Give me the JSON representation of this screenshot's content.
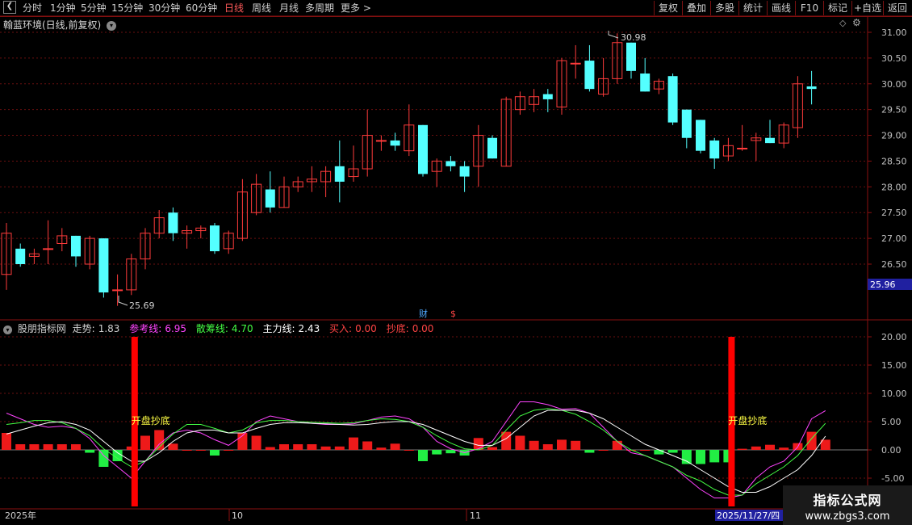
{
  "toolbar": {
    "periods": [
      "分时",
      "1分钟",
      "5分钟",
      "15分钟",
      "30分钟",
      "60分钟",
      "日线",
      "周线",
      "月线",
      "多周期",
      "更多 >"
    ],
    "active_period": "日线",
    "right_buttons": [
      "复权",
      "叠加",
      "多股",
      "统计",
      "画线",
      "F10",
      "标记",
      "+自选",
      "返回"
    ]
  },
  "stock_title": "翰蓝环境(日线,前复权)",
  "main_chart": {
    "y_ticks": [
      "31.00",
      "30.50",
      "30.00",
      "29.50",
      "29.00",
      "28.50",
      "28.00",
      "27.50",
      "27.00",
      "26.50"
    ],
    "price_ylim": [
      25.75,
      31.2
    ],
    "high_label": "30.98",
    "low_label": "25.69",
    "current_price": "25.96",
    "markers": {
      "cai": "财",
      "dollar": "$"
    }
  },
  "indicator": {
    "name": "股朋指标网",
    "items": [
      {
        "label": "走势:",
        "value": "1.83",
        "color": "#d0d0d0"
      },
      {
        "label": "参考线:",
        "value": "6.95",
        "color": "#ff44ff"
      },
      {
        "label": "散筹线:",
        "value": "4.70",
        "color": "#44ff44"
      },
      {
        "label": "主力线:",
        "value": "2.43",
        "color": "#ffffff"
      },
      {
        "label": "买入:",
        "value": "0.00",
        "color": "#ff4444"
      },
      {
        "label": "抄底:",
        "value": "0.00",
        "color": "#ff4444"
      }
    ],
    "y_ticks": [
      "20.00",
      "15.00",
      "10.00",
      "5.00",
      "0.00",
      "-5.00"
    ],
    "signal_text": "开盘抄底",
    "ylim": [
      -10.5,
      21.5
    ]
  },
  "xaxis": {
    "labels": [
      "2025年",
      "10",
      "11"
    ],
    "cursor_date": "2025/11/27/四"
  },
  "watermark": {
    "line1": "指标公式网",
    "line2": "www.zbgs3.com"
  },
  "chart_data": {
    "type": "candlestick",
    "candles": [
      [
        26.3,
        27.1,
        26.0,
        27.3
      ],
      [
        26.8,
        26.5,
        26.45,
        26.9
      ],
      [
        26.65,
        26.7,
        26.5,
        26.8
      ],
      [
        26.8,
        26.8,
        26.5,
        27.35
      ],
      [
        26.9,
        27.05,
        26.75,
        27.2
      ],
      [
        27.05,
        26.65,
        26.45,
        27.05
      ],
      [
        26.5,
        27.0,
        26.4,
        27.05
      ],
      [
        27.0,
        25.95,
        25.85,
        27.0
      ],
      [
        26.0,
        26.0,
        25.69,
        26.3
      ],
      [
        26.0,
        26.6,
        25.9,
        26.7
      ],
      [
        26.6,
        27.1,
        26.4,
        27.2
      ],
      [
        27.1,
        27.4,
        27.0,
        27.55
      ],
      [
        27.5,
        27.1,
        26.95,
        27.6
      ],
      [
        27.1,
        27.15,
        26.8,
        27.25
      ],
      [
        27.15,
        27.2,
        27.0,
        27.25
      ],
      [
        27.25,
        26.75,
        26.7,
        27.3
      ],
      [
        26.8,
        27.1,
        26.7,
        27.15
      ],
      [
        27.0,
        27.9,
        26.95,
        28.15
      ],
      [
        27.5,
        28.05,
        27.45,
        28.25
      ],
      [
        27.95,
        27.6,
        27.5,
        28.3
      ],
      [
        27.6,
        28.0,
        27.6,
        28.2
      ],
      [
        28.0,
        28.1,
        27.9,
        28.2
      ],
      [
        28.1,
        28.15,
        27.9,
        28.4
      ],
      [
        28.1,
        28.3,
        27.8,
        28.4
      ],
      [
        28.4,
        28.1,
        27.7,
        28.9
      ],
      [
        28.2,
        28.35,
        28.1,
        28.8
      ],
      [
        28.35,
        29.0,
        28.2,
        29.5
      ],
      [
        28.9,
        28.9,
        28.7,
        29.0
      ],
      [
        28.9,
        28.8,
        28.7,
        29.05
      ],
      [
        28.7,
        29.2,
        28.6,
        29.6
      ],
      [
        29.2,
        28.25,
        28.2,
        29.2
      ],
      [
        28.3,
        28.5,
        28.0,
        28.55
      ],
      [
        28.5,
        28.4,
        28.3,
        28.6
      ],
      [
        28.4,
        28.2,
        27.9,
        28.5
      ],
      [
        28.4,
        29.0,
        28.0,
        29.2
      ],
      [
        28.95,
        28.55,
        28.55,
        29.0
      ],
      [
        28.4,
        29.7,
        28.4,
        29.75
      ],
      [
        29.5,
        29.75,
        29.4,
        29.85
      ],
      [
        29.6,
        29.75,
        29.45,
        29.9
      ],
      [
        29.8,
        29.7,
        29.45,
        29.9
      ],
      [
        29.55,
        30.45,
        29.4,
        30.5
      ],
      [
        30.4,
        30.4,
        30.1,
        30.75
      ],
      [
        30.45,
        29.9,
        29.85,
        30.75
      ],
      [
        29.8,
        30.1,
        29.75,
        30.5
      ],
      [
        30.1,
        30.8,
        30.0,
        30.98
      ],
      [
        30.8,
        30.25,
        30.1,
        30.8
      ],
      [
        30.2,
        29.85,
        29.85,
        30.5
      ],
      [
        29.9,
        30.05,
        29.8,
        30.1
      ],
      [
        30.15,
        29.25,
        29.2,
        30.2
      ],
      [
        29.5,
        28.95,
        28.75,
        29.5
      ],
      [
        29.3,
        28.7,
        28.65,
        29.3
      ],
      [
        28.9,
        28.55,
        28.35,
        28.95
      ],
      [
        28.6,
        28.8,
        28.5,
        28.95
      ],
      [
        28.75,
        28.75,
        28.7,
        29.2
      ],
      [
        28.9,
        28.95,
        28.5,
        29.05
      ],
      [
        28.95,
        28.85,
        28.85,
        29.3
      ],
      [
        28.85,
        29.2,
        28.75,
        29.25
      ],
      [
        29.15,
        30.0,
        28.95,
        30.15
      ],
      [
        29.95,
        29.9,
        29.6,
        30.25
      ]
    ],
    "histogram": [
      3,
      1,
      1,
      1,
      1,
      1,
      -0.5,
      -3,
      -2,
      0.6,
      2.5,
      3.5,
      1.1,
      0,
      0,
      -1,
      0,
      3,
      2.5,
      0.5,
      1,
      1,
      1,
      0.6,
      0.6,
      2.2,
      1.5,
      0.4,
      1.1,
      0,
      -2,
      -0.8,
      -0.6,
      -1,
      2.1,
      0.5,
      3.2,
      2.5,
      1.6,
      1.0,
      1.8,
      1.6,
      -0.5,
      0,
      1.6,
      0,
      0,
      -0.8,
      -0.5,
      -2.5,
      -2.5,
      -2.2,
      -2.2,
      0.2,
      0.6,
      0.9,
      0.4,
      1.2,
      3.2,
      1.8
    ],
    "series": [
      {
        "name": "参考线",
        "color": "#ff44ff",
        "values": [
          6.5,
          5.5,
          4.5,
          4,
          4.2,
          3.8,
          2,
          -1,
          -3,
          -5,
          -2,
          1,
          3,
          3.5,
          3,
          1.8,
          0.8,
          2.5,
          5,
          6,
          5.5,
          5,
          4.7,
          4.5,
          4.5,
          4.6,
          5.2,
          5.8,
          6,
          5.5,
          4,
          1.5,
          0.2,
          -0.5,
          0.2,
          1.5,
          5,
          8.5,
          8.5,
          8,
          7.2,
          7.3,
          6.5,
          4,
          1.5,
          -0.5,
          -1,
          -2,
          -3,
          -5,
          -7,
          -8.5,
          -8.5,
          -8,
          -5,
          -3,
          -2,
          0.5,
          5.5,
          6.95
        ]
      },
      {
        "name": "散筹线",
        "color": "#44ff44",
        "values": [
          4.5,
          4.8,
          5.2,
          5.2,
          4.8,
          3.8,
          2.5,
          0.2,
          -1.5,
          -3,
          -2,
          0.5,
          2.8,
          4.5,
          4.5,
          3.8,
          3,
          3.5,
          4.8,
          5.2,
          5.2,
          5,
          4.9,
          4.8,
          4.7,
          4.8,
          5.2,
          5.5,
          5.4,
          5,
          4,
          2.5,
          1.2,
          0.2,
          0,
          0.8,
          3.5,
          6,
          7,
          7.3,
          7,
          6.3,
          5,
          3.5,
          1.5,
          0,
          -1,
          -2,
          -3,
          -4.5,
          -5.5,
          -7,
          -8,
          -8,
          -6,
          -4.5,
          -3,
          -1,
          2,
          4.7
        ]
      },
      {
        "name": "主力线",
        "color": "#ffffff",
        "values": [
          2.8,
          3.5,
          4.2,
          4.8,
          5,
          4.5,
          3.5,
          1.5,
          -0.5,
          -2,
          -2,
          -0.5,
          1.5,
          3,
          3.5,
          3.5,
          3,
          3,
          3.8,
          4.5,
          4.8,
          4.8,
          4.7,
          4.6,
          4.5,
          4.4,
          4.5,
          4.8,
          5,
          5,
          4.5,
          3.5,
          2.5,
          1.5,
          0.8,
          0.8,
          2,
          4,
          6,
          7,
          7,
          7,
          6.5,
          5.5,
          4,
          2.5,
          1,
          0,
          -1,
          -2,
          -3.5,
          -5,
          -6.5,
          -7.5,
          -7.5,
          -6.5,
          -5,
          -3.5,
          -1,
          2.43
        ]
      }
    ],
    "signal_bar_indices": [
      9,
      52
    ]
  }
}
